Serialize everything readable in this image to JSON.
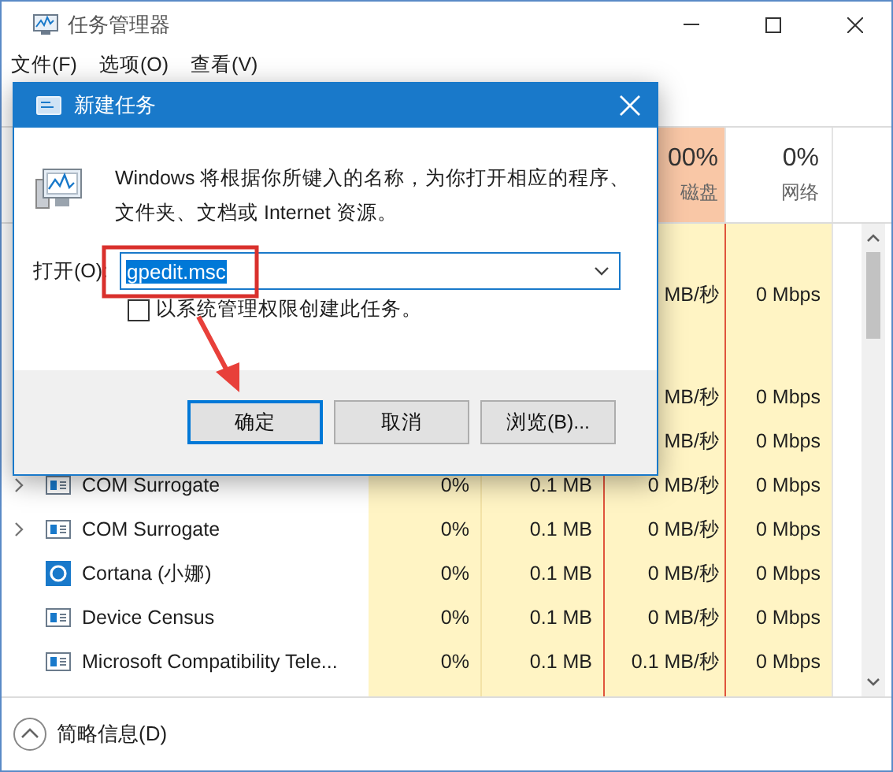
{
  "window": {
    "title": "任务管理器"
  },
  "menu": [
    "文件(F)",
    "选项(O)",
    "查看(V)"
  ],
  "columns": [
    {
      "usage": "00%",
      "label": "磁盘",
      "highlighted": true
    },
    {
      "usage": "0%",
      "label": "网络",
      "highlighted": false
    }
  ],
  "rows": [
    {
      "disk": "MB/秒",
      "network": "0 Mbps"
    },
    {
      "disk": "MB/秒",
      "network": "0 Mbps"
    },
    {
      "disk": "MB/秒",
      "network": "0 Mbps"
    },
    {
      "kind": "service",
      "expandable": true,
      "name": "COM Surrogate",
      "cpu": "0%",
      "memory": "0.1 MB",
      "disk": "0 MB/秒",
      "network": "0 Mbps"
    },
    {
      "kind": "service",
      "expandable": true,
      "name": "COM Surrogate",
      "cpu": "0%",
      "memory": "0.1 MB",
      "disk": "0 MB/秒",
      "network": "0 Mbps"
    },
    {
      "kind": "cortana",
      "expandable": false,
      "name": "Cortana (小娜)",
      "cpu": "0%",
      "memory": "0.1 MB",
      "disk": "0 MB/秒",
      "network": "0 Mbps"
    },
    {
      "kind": "service",
      "expandable": false,
      "name": "Device Census",
      "cpu": "0%",
      "memory": "0.1 MB",
      "disk": "0 MB/秒",
      "network": "0 Mbps"
    },
    {
      "kind": "service",
      "expandable": false,
      "name": "Microsoft Compatibility Tele...",
      "cpu": "0%",
      "memory": "0.1 MB",
      "disk": "0.1 MB/秒",
      "network": "0 Mbps"
    }
  ],
  "footer": {
    "label": "简略信息(D)"
  },
  "dialog": {
    "title": "新建任务",
    "description": "Windows 将根据你所键入的名称，为你打开相应的程序、文件夹、文档或 Internet 资源。",
    "open_label": "打开(O):",
    "open_value": "gpedit.msc",
    "open_value_selected": true,
    "checkbox": {
      "label": "以系统管理权限创建此任务。",
      "checked": false
    },
    "buttons": [
      {
        "label": "确定",
        "default": true
      },
      {
        "label": "取消",
        "default": false
      },
      {
        "label": "浏览(B)...",
        "default": false
      }
    ]
  }
}
